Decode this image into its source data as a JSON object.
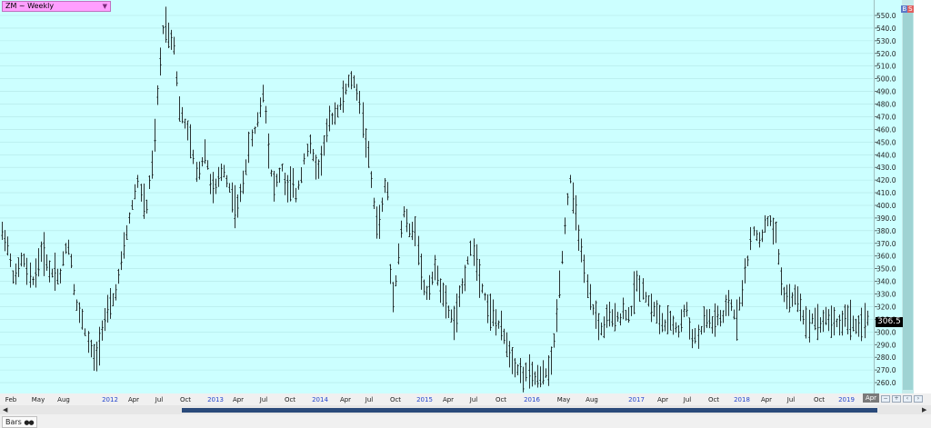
{
  "window": {
    "symbol_label": "ZM ~ Weekly",
    "last_price_label": "306.5",
    "current_date_label": "Apr",
    "bottom_tab_label": "Bars",
    "bs_buy": "B",
    "bs_sell": "S"
  },
  "colors": {
    "plot_background": "#ccffff",
    "bars": "#000000",
    "month_label": "#1a1a1a",
    "year_label": "#2244cc",
    "symbol_box": "#ff9fff"
  },
  "chart_data": {
    "type": "ohlc-bar",
    "title": "",
    "xlabel": "",
    "ylabel": "",
    "ylim": [
      250,
      560
    ],
    "y_ticks": [
      260,
      270,
      280,
      290,
      300,
      310,
      320,
      330,
      340,
      350,
      360,
      370,
      380,
      390,
      400,
      410,
      420,
      430,
      440,
      450,
      460,
      470,
      480,
      490,
      500,
      510,
      520,
      530,
      540,
      550
    ],
    "y_tick_labels": [
      "260.0",
      "270.0",
      "280.0",
      "290.0",
      "300.0",
      "310.0",
      "320.0",
      "330.0",
      "340.0",
      "350.0",
      "360.0",
      "370.0",
      "380.0",
      "390.0",
      "400.0",
      "410.0",
      "420.0",
      "430.0",
      "440.0",
      "450.0",
      "460.0",
      "470.0",
      "480.0",
      "490.0",
      "500.0",
      "510.0",
      "520.0",
      "530.0",
      "540.0",
      "550.0"
    ],
    "grid": true,
    "x_axis_labels": [
      {
        "label": "Feb",
        "year": false
      },
      {
        "label": "May",
        "year": false
      },
      {
        "label": "Aug",
        "year": false
      },
      {
        "label": "2012",
        "year": true
      },
      {
        "label": "Apr",
        "year": false
      },
      {
        "label": "Jul",
        "year": false
      },
      {
        "label": "Oct",
        "year": false
      },
      {
        "label": "2013",
        "year": true
      },
      {
        "label": "Apr",
        "year": false
      },
      {
        "label": "Jul",
        "year": false
      },
      {
        "label": "Oct",
        "year": false
      },
      {
        "label": "2014",
        "year": true
      },
      {
        "label": "Apr",
        "year": false
      },
      {
        "label": "Jul",
        "year": false
      },
      {
        "label": "Oct",
        "year": false
      },
      {
        "label": "2015",
        "year": true
      },
      {
        "label": "Apr",
        "year": false
      },
      {
        "label": "Jul",
        "year": false
      },
      {
        "label": "Oct",
        "year": false
      },
      {
        "label": "2016",
        "year": true
      },
      {
        "label": "May",
        "year": false
      },
      {
        "label": "Aug",
        "year": false
      },
      {
        "label": "2017",
        "year": true
      },
      {
        "label": "Apr",
        "year": false
      },
      {
        "label": "Jul",
        "year": false
      },
      {
        "label": "Oct",
        "year": false
      },
      {
        "label": "2018",
        "year": true
      },
      {
        "label": "Apr",
        "year": false
      },
      {
        "label": "Jul",
        "year": false
      },
      {
        "label": "Oct",
        "year": false
      },
      {
        "label": "2019",
        "year": true
      }
    ],
    "path_anchors": [
      [
        0,
        375
      ],
      [
        3,
        380
      ],
      [
        8,
        368
      ],
      [
        12,
        352
      ],
      [
        16,
        340
      ],
      [
        20,
        350
      ],
      [
        25,
        360
      ],
      [
        30,
        345
      ],
      [
        35,
        340
      ],
      [
        40,
        350
      ],
      [
        45,
        365
      ],
      [
        50,
        358
      ],
      [
        55,
        345
      ],
      [
        60,
        350
      ],
      [
        65,
        340
      ],
      [
        70,
        360
      ],
      [
        74,
        372
      ],
      [
        78,
        358
      ],
      [
        82,
        330
      ],
      [
        86,
        315
      ],
      [
        90,
        312
      ],
      [
        95,
        295
      ],
      [
        100,
        285
      ],
      [
        104,
        276
      ],
      [
        108,
        288
      ],
      [
        112,
        305
      ],
      [
        116,
        312
      ],
      [
        120,
        318
      ],
      [
        124,
        325
      ],
      [
        128,
        335
      ],
      [
        132,
        350
      ],
      [
        136,
        365
      ],
      [
        140,
        382
      ],
      [
        144,
        395
      ],
      [
        148,
        410
      ],
      [
        152,
        420
      ],
      [
        156,
        405
      ],
      [
        160,
        395
      ],
      [
        164,
        420
      ],
      [
        168,
        435
      ],
      [
        172,
        478
      ],
      [
        176,
        515
      ],
      [
        179,
        540
      ],
      [
        182,
        545
      ],
      [
        186,
        530
      ],
      [
        190,
        535
      ],
      [
        193,
        515
      ],
      [
        196,
        478
      ],
      [
        200,
        470
      ],
      [
        205,
        462
      ],
      [
        210,
        448
      ],
      [
        215,
        425
      ],
      [
        220,
        430
      ],
      [
        225,
        445
      ],
      [
        230,
        420
      ],
      [
        235,
        410
      ],
      [
        240,
        420
      ],
      [
        245,
        430
      ],
      [
        250,
        418
      ],
      [
        255,
        408
      ],
      [
        260,
        395
      ],
      [
        265,
        410
      ],
      [
        270,
        430
      ],
      [
        275,
        450
      ],
      [
        280,
        460
      ],
      [
        285,
        475
      ],
      [
        289,
        490
      ],
      [
        292,
        472
      ],
      [
        296,
        435
      ],
      [
        300,
        415
      ],
      [
        305,
        420
      ],
      [
        310,
        430
      ],
      [
        315,
        410
      ],
      [
        320,
        418
      ],
      [
        325,
        408
      ],
      [
        330,
        420
      ],
      [
        335,
        440
      ],
      [
        340,
        448
      ],
      [
        345,
        435
      ],
      [
        350,
        428
      ],
      [
        355,
        445
      ],
      [
        360,
        462
      ],
      [
        365,
        470
      ],
      [
        370,
        475
      ],
      [
        375,
        480
      ],
      [
        378,
        488
      ],
      [
        382,
        495
      ],
      [
        386,
        500
      ],
      [
        390,
        495
      ],
      [
        394,
        488
      ],
      [
        398,
        470
      ],
      [
        402,
        450
      ],
      [
        406,
        430
      ],
      [
        410,
        405
      ],
      [
        414,
        385
      ],
      [
        418,
        390
      ],
      [
        422,
        410
      ],
      [
        425,
        430
      ],
      [
        430,
        325
      ],
      [
        433,
        335
      ],
      [
        436,
        345
      ],
      [
        440,
        375
      ],
      [
        444,
        395
      ],
      [
        448,
        385
      ],
      [
        452,
        375
      ],
      [
        456,
        385
      ],
      [
        460,
        365
      ],
      [
        464,
        338
      ],
      [
        468,
        330
      ],
      [
        472,
        338
      ],
      [
        476,
        345
      ],
      [
        480,
        350
      ],
      [
        484,
        335
      ],
      [
        488,
        325
      ],
      [
        492,
        318
      ],
      [
        496,
        312
      ],
      [
        500,
        308
      ],
      [
        504,
        320
      ],
      [
        508,
        335
      ],
      [
        512,
        348
      ],
      [
        516,
        362
      ],
      [
        520,
        368
      ],
      [
        524,
        355
      ],
      [
        528,
        340
      ],
      [
        532,
        330
      ],
      [
        536,
        320
      ],
      [
        540,
        315
      ],
      [
        544,
        310
      ],
      [
        548,
        305
      ],
      [
        552,
        300
      ],
      [
        556,
        293
      ],
      [
        560,
        285
      ],
      [
        564,
        278
      ],
      [
        568,
        272
      ],
      [
        572,
        268
      ],
      [
        576,
        265
      ],
      [
        580,
        268
      ],
      [
        584,
        265
      ],
      [
        588,
        264
      ],
      [
        592,
        262
      ],
      [
        596,
        265
      ],
      [
        600,
        268
      ],
      [
        604,
        270
      ],
      [
        608,
        285
      ],
      [
        612,
        315
      ],
      [
        616,
        345
      ],
      [
        620,
        375
      ],
      [
        624,
        405
      ],
      [
        627,
        422
      ],
      [
        630,
        405
      ],
      [
        634,
        390
      ],
      [
        638,
        370
      ],
      [
        642,
        348
      ],
      [
        646,
        332
      ],
      [
        650,
        320
      ],
      [
        654,
        315
      ],
      [
        658,
        305
      ],
      [
        662,
        300
      ],
      [
        666,
        310
      ],
      [
        670,
        312
      ],
      [
        674,
        308
      ],
      [
        678,
        315
      ],
      [
        682,
        310
      ],
      [
        686,
        318
      ],
      [
        690,
        312
      ],
      [
        694,
        315
      ],
      [
        698,
        335
      ],
      [
        702,
        340
      ],
      [
        706,
        335
      ],
      [
        710,
        328
      ],
      [
        714,
        322
      ],
      [
        718,
        318
      ],
      [
        722,
        315
      ],
      [
        726,
        308
      ],
      [
        730,
        305
      ],
      [
        734,
        306
      ],
      [
        738,
        308
      ],
      [
        742,
        305
      ],
      [
        746,
        300
      ],
      [
        750,
        310
      ],
      [
        754,
        322
      ],
      [
        758,
        305
      ],
      [
        762,
        296
      ],
      [
        766,
        295
      ],
      [
        770,
        300
      ],
      [
        774,
        308
      ],
      [
        778,
        312
      ],
      [
        782,
        305
      ],
      [
        786,
        310
      ],
      [
        790,
        312
      ],
      [
        794,
        308
      ],
      [
        798,
        318
      ],
      [
        802,
        325
      ],
      [
        806,
        316
      ],
      [
        810,
        310
      ],
      [
        814,
        325
      ],
      [
        818,
        340
      ],
      [
        822,
        355
      ],
      [
        826,
        375
      ],
      [
        830,
        380
      ],
      [
        834,
        372
      ],
      [
        838,
        378
      ],
      [
        842,
        385
      ],
      [
        846,
        390
      ],
      [
        850,
        380
      ],
      [
        854,
        375
      ],
      [
        858,
        345
      ],
      [
        862,
        330
      ],
      [
        866,
        328
      ],
      [
        870,
        322
      ],
      [
        874,
        330
      ],
      [
        878,
        325
      ],
      [
        882,
        318
      ],
      [
        886,
        305
      ],
      [
        890,
        308
      ],
      [
        894,
        312
      ],
      [
        898,
        310
      ],
      [
        902,
        306
      ],
      [
        906,
        310
      ],
      [
        910,
        312
      ],
      [
        914,
        308
      ],
      [
        918,
        310
      ],
      [
        922,
        305
      ],
      [
        926,
        308
      ],
      [
        930,
        313
      ],
      [
        934,
        310
      ],
      [
        938,
        308
      ],
      [
        942,
        303
      ],
      [
        946,
        300
      ],
      [
        950,
        310
      ],
      [
        954,
        313
      ]
    ]
  }
}
